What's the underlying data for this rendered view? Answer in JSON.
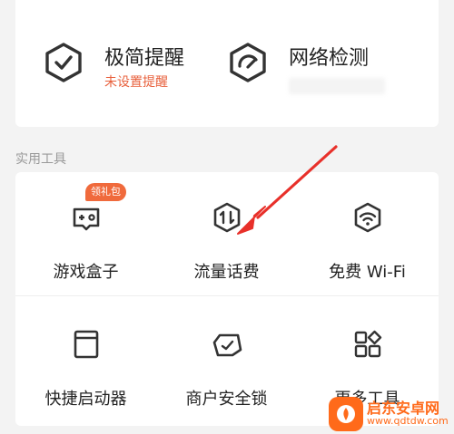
{
  "features": [
    {
      "title": "极简提醒",
      "subtitle": "未设置提醒",
      "icon": "hex-check-icon"
    },
    {
      "title": "网络检测",
      "subtitle": "",
      "icon": "hex-speed-icon"
    }
  ],
  "section": {
    "label": "实用工具"
  },
  "tools": [
    {
      "label": "游戏盒子",
      "icon": "gamepad-icon",
      "badge": "领礼包"
    },
    {
      "label": "流量话费",
      "icon": "data-traffic-icon"
    },
    {
      "label": "免费 Wi-Fi",
      "icon": "wifi-shield-icon"
    },
    {
      "label": "快捷启动器",
      "icon": "launcher-icon"
    },
    {
      "label": "商户安全锁",
      "icon": "merchant-lock-icon"
    },
    {
      "label": "更多工具",
      "icon": "grid-more-icon"
    }
  ],
  "watermark": {
    "title": "启东安卓网",
    "url": "www.qdtdw.com"
  },
  "colors": {
    "accent": "#e8603c",
    "badge": "#f06a3c",
    "arrow": "#e8302a"
  }
}
